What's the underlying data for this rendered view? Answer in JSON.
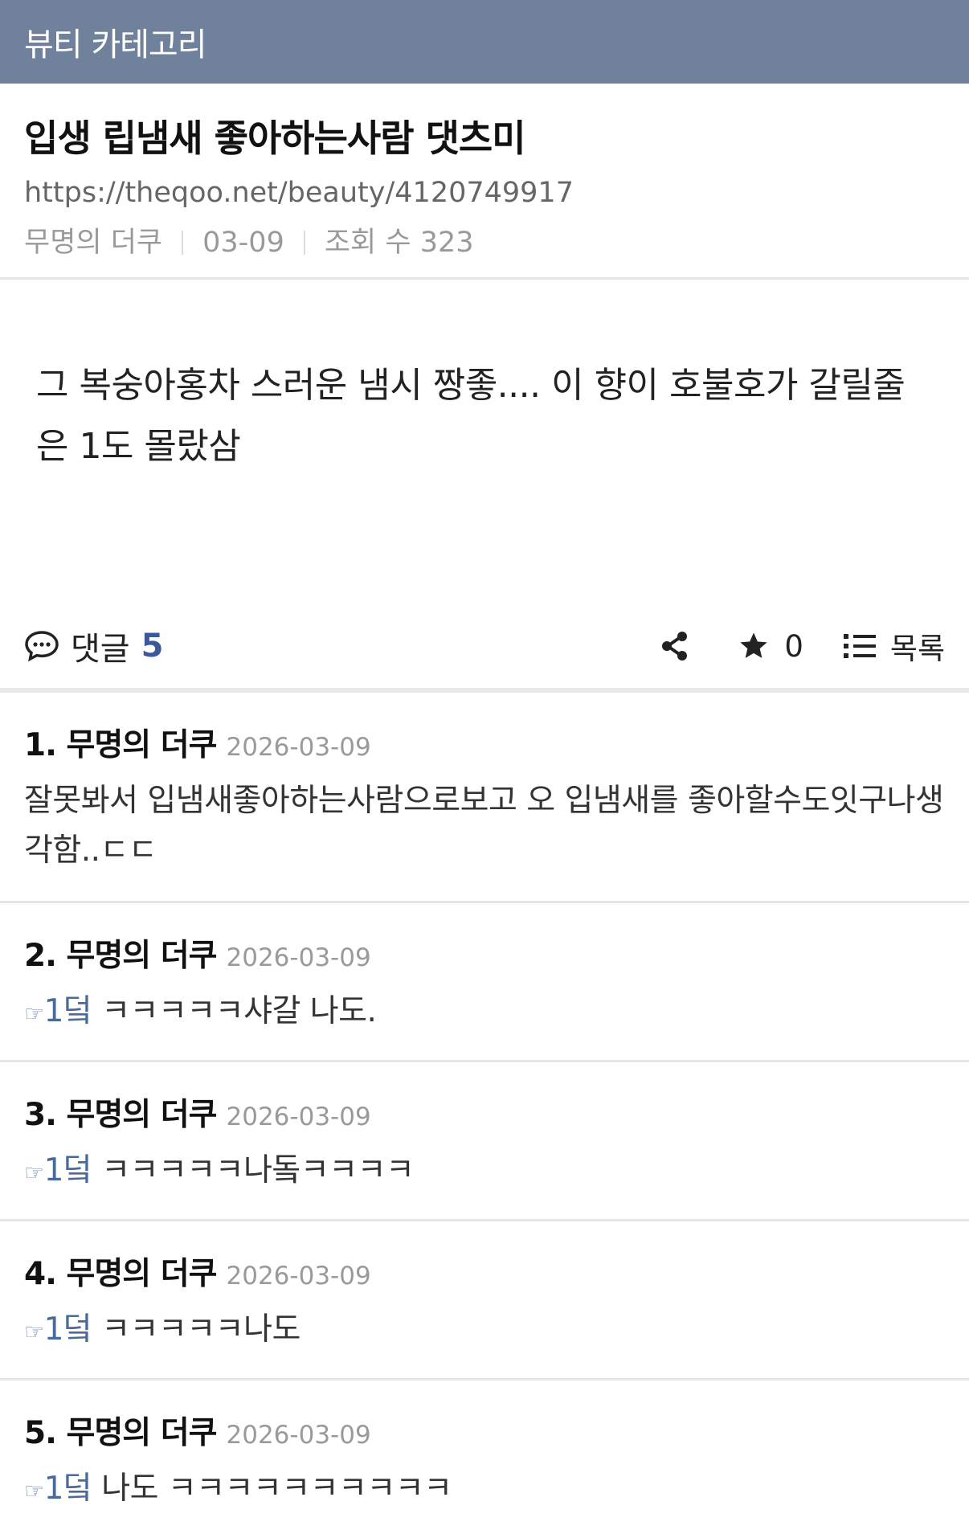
{
  "header": {
    "category": "뷰티 카테고리"
  },
  "post": {
    "title": "입생 립냄새 좋아하는사람 댓츠미",
    "url": "https://theqoo.net/beauty/4120749917",
    "author": "무명의 더쿠",
    "date": "03-09",
    "views_label": "조회 수 323",
    "body": "그 복숭아홍차 스러운 냄시 짱좋.... 이 향이 호불호가 갈릴줄은 1도 몰랐삼"
  },
  "actions": {
    "comments_label": "댓글",
    "comments_count": "5",
    "star_count": "0",
    "list_label": "목록"
  },
  "icons": {
    "comment": "speech-bubble-icon",
    "share": "share-icon",
    "star": "star-icon",
    "list": "list-icon"
  },
  "comments": [
    {
      "author": "1. 무명의 더쿠",
      "date": "2026-03-09",
      "ref": "",
      "text": "잘못봐서 입냄새좋아하는사람으로보고 오 입냄새를 좋아할수도잇구나생각함..ㄷㄷ"
    },
    {
      "author": "2. 무명의 더쿠",
      "date": "2026-03-09",
      "ref": "1덬",
      "text": "ㅋㅋㅋㅋㅋ샤갈 나도."
    },
    {
      "author": "3. 무명의 더쿠",
      "date": "2026-03-09",
      "ref": "1덬",
      "text": "ㅋㅋㅋㅋㅋ나돜ㅋㅋㅋㅋ"
    },
    {
      "author": "4. 무명의 더쿠",
      "date": "2026-03-09",
      "ref": "1덬",
      "text": "ㅋㅋㅋㅋㅋ나도"
    },
    {
      "author": "5. 무명의 더쿠",
      "date": "2026-03-09",
      "ref": "1덬",
      "text": "나도 ㅋㅋㅋㅋㅋㅋㅋㅋㅋㅋ"
    }
  ],
  "colors": {
    "header_bg": "#6f819b",
    "accent": "#3b5998"
  }
}
